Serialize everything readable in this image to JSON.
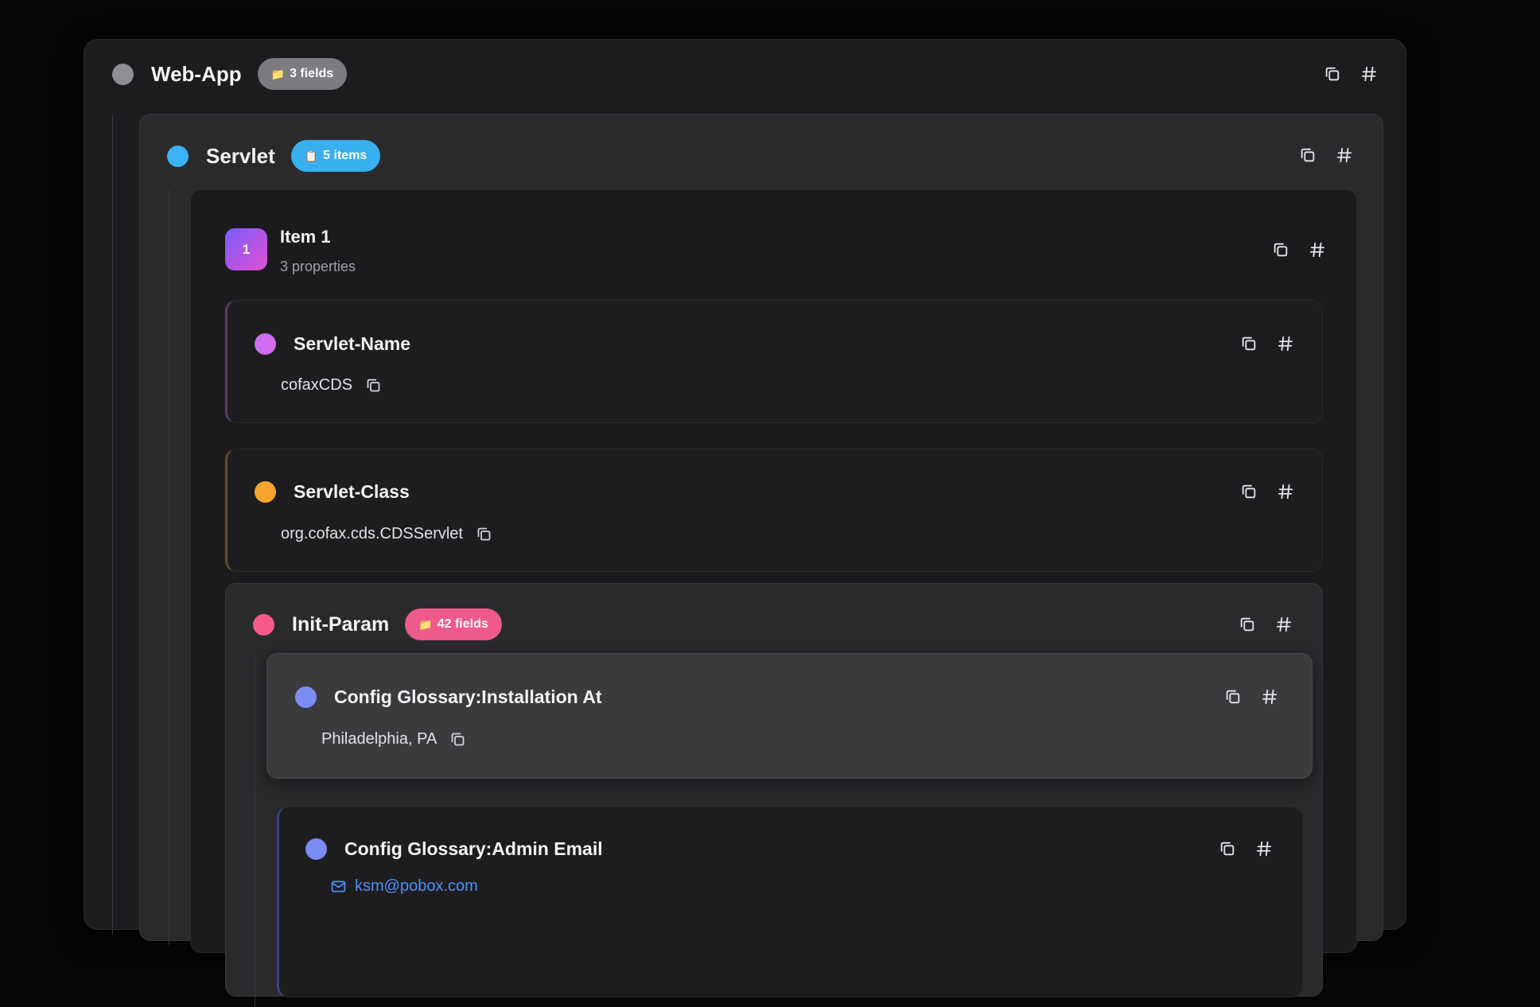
{
  "web_app": {
    "title": "Web-App",
    "badge_icon": "📁",
    "badge_label": "3 fields",
    "dot_color": "#8e8e93",
    "badge_color": "#7b7b80"
  },
  "servlet": {
    "title": "Servlet",
    "badge_icon": "📋",
    "badge_label": "5 items",
    "dot_color": "#3bb3f5",
    "badge_color": "#38b0ef"
  },
  "item": {
    "number": "1",
    "title": "Item 1",
    "subtitle": "3 properties"
  },
  "servlet_name": {
    "title": "Servlet-Name",
    "value": "cofaxCDS",
    "dot_color": "#cf6ef1",
    "accent_color": "#5a3a70"
  },
  "servlet_class": {
    "title": "Servlet-Class",
    "value": "org.cofax.cds.CDSServlet",
    "dot_color": "#f5a52d",
    "accent_color": "#6a4a20"
  },
  "init_param": {
    "title": "Init-Param",
    "badge_icon": "📁",
    "badge_label": "42 fields",
    "dot_color": "#f55a8a",
    "badge_color": "#ef5a8c"
  },
  "installation_at": {
    "title": "Config Glossary:Installation At",
    "value": "Philadelphia, PA",
    "dot_color": "#7b8cf5"
  },
  "admin_email": {
    "title": "Config Glossary:Admin Email",
    "value": "ksm@pobox.com",
    "dot_color": "#7b8cf5",
    "accent_color": "#3a4680"
  },
  "icons": {
    "copy": "copy-icon",
    "hash": "hash-icon",
    "mail": "mail-icon"
  }
}
